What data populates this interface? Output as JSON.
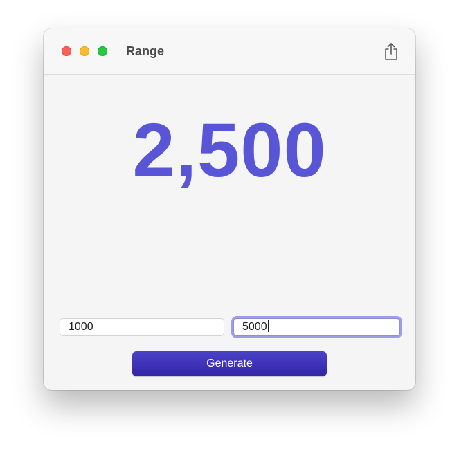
{
  "window": {
    "title": "Range",
    "controls": {
      "close_icon": "close-icon",
      "minimize_icon": "minimize-icon",
      "zoom_icon": "zoom-icon"
    },
    "share_icon": "share-icon"
  },
  "main": {
    "result": "2,500",
    "min_value": "1000",
    "max_value": "5000",
    "generate_label": "Generate"
  },
  "colors": {
    "accent": "#5856d6",
    "button": "#3a2cb0",
    "focus_ring": "#9e9de6"
  }
}
